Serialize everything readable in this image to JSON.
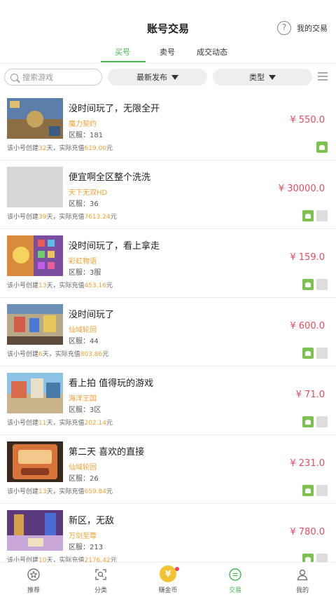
{
  "header": {
    "title": "账号交易",
    "my_trade": "我的交易",
    "help_icon": "question-circle-icon"
  },
  "tabs": [
    {
      "label": "买号",
      "active": true
    },
    {
      "label": "卖号",
      "active": false
    },
    {
      "label": "成交动态",
      "active": false
    }
  ],
  "filters": {
    "search_placeholder": "搜索游戏",
    "sort_label": "最新发布",
    "type_label": "类型"
  },
  "items": [
    {
      "title": "没时间玩了，无限全开",
      "game": "魔力契约",
      "server": "区服：181",
      "price": "¥ 550.0",
      "meta_prefix": "该小号创建",
      "days": "32",
      "meta_mid": "天，实际充值",
      "recharge": "619.00",
      "meta_suffix": "元",
      "ios": false
    },
    {
      "title": "便宜啊全区整个洗洗",
      "game": "天下无双HD",
      "server": "区服：36",
      "price": "¥ 30000.0",
      "meta_prefix": "该小号创建",
      "days": "39",
      "meta_mid": "天，实际充值",
      "recharge": "7613.24",
      "meta_suffix": "元",
      "ios": true
    },
    {
      "title": "没时间玩了，看上拿走",
      "game": "彩虹物语",
      "server": "区服：3服",
      "price": "¥ 159.0",
      "meta_prefix": "该小号创建",
      "days": "13",
      "meta_mid": "天，实际充值",
      "recharge": "453.16",
      "meta_suffix": "元",
      "ios": true
    },
    {
      "title": "没时间玩了",
      "game": "仙域轮回",
      "server": "区服：44",
      "price": "¥ 600.0",
      "meta_prefix": "该小号创建",
      "days": "6",
      "meta_mid": "天，实际充值",
      "recharge": "803.86",
      "meta_suffix": "元",
      "ios": true
    },
    {
      "title": "看上拍 值得玩的游戏",
      "game": "海洋王国",
      "server": "区服：3区",
      "price": "¥ 71.0",
      "meta_prefix": "该小号创建",
      "days": "11",
      "meta_mid": "天，实际充值",
      "recharge": "202.14",
      "meta_suffix": "元",
      "ios": true
    },
    {
      "title": "第二天 喜欢的直接",
      "game": "仙域轮回",
      "server": "区服：26",
      "price": "¥ 231.0",
      "meta_prefix": "该小号创建",
      "days": "13",
      "meta_mid": "天，实际充值",
      "recharge": "659.84",
      "meta_suffix": "元",
      "ios": true
    },
    {
      "title": "新区，无敌",
      "game": "万剑至尊",
      "server": "区服：213",
      "price": "¥ 780.0",
      "meta_prefix": "该小号创建",
      "days": "10",
      "meta_mid": "天，实际充值",
      "recharge": "2176.42",
      "meta_suffix": "元",
      "ios": true
    }
  ],
  "bottom_nav": [
    {
      "label": "推荐",
      "icon": "star-circle-icon",
      "active": false
    },
    {
      "label": "分类",
      "icon": "category-scan-icon",
      "active": false
    },
    {
      "label": "赚金币",
      "icon": "coin-icon",
      "active": false,
      "badge": true,
      "coin_glyph": "¥"
    },
    {
      "label": "交易",
      "icon": "trade-chat-icon",
      "active": true
    },
    {
      "label": "我的",
      "icon": "user-icon",
      "active": false
    }
  ],
  "colors": {
    "accent_green": "#43b84d",
    "price_red": "#e94b5f",
    "game_orange": "#f0a030"
  }
}
